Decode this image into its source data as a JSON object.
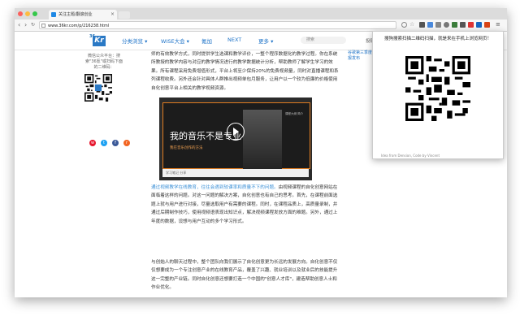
{
  "browser": {
    "tab_title": "关注主题/翻滚创业",
    "url": "www.36kr.com/p/216238.html",
    "colors": {
      "close": "#fc605c",
      "min": "#fdbc40",
      "max": "#34c84a"
    }
  },
  "site": {
    "logo_small": "36",
    "logo_big": "Kr",
    "nav": [
      "分类浏览 ▾",
      "WISE大会 ▾",
      "氪加",
      "NEXT",
      "更多 ▾"
    ],
    "search_placeholder": "搜索",
    "right_text": "投稿"
  },
  "left": {
    "text": "微信公众平台：搜索\"36氪\"或扫码下面的二维码："
  },
  "article": {
    "p1": "师的有效教学方式，同时提供学生选课和教学评价，一整个程序数据化的教学过程。你在系统所教授的教学内容与对应的教学情况进行的教学数据统计分析，帮助教师了解学生学习的效果。所有课程采用免费增值形式，平台上将至少保持20%的免费视频量，同时对直播课程和系列课程收费。另外还会针对具体人群推出视频单包月服务，让用户以一个较为低廉的价格使用自化创意平台上相关的教学视频资源。",
    "p2_link": "通过视频教学在线教育，往往会遇到较课率和质量不下的问题。",
    "p2": "由视频课程的自化创意网站在面临着这样的问题。对这一问题的解决方案，自化创意也有自己的思考。首先，在课程前面选题上就与用户进行对接，尽量选取用户有需要的课程。同时，在课程品质上，高质量录制，并通过后期制作技巧，使用视频语表现出知识点，解决视频课程发放方面的难题。另外，通过上年度的数据，设想与用户互动的多个学习形式。",
    "p3": "与创始人的聊天过程中，整个团队向我们展示了自化创意更为长远的发展方向。自化创意不仅仅想要成为一个专注创意产业的在线教育产品，覆盖了兴趣、就业培训以及就业后的技能提升这一完整的产业链。同时自化创意还想要打造一个中国的\"创意人才库\"，建造帮助创意人士和作业优化。"
  },
  "video": {
    "title": "我的音乐不是专业",
    "subtitle": "我在音乐创作的方法",
    "right_text": "课程大纲·简介",
    "bar": "学习笔记  分享"
  },
  "right_sidebar": {
    "text": "谷歌第三季度财报发布"
  },
  "popup": {
    "message": "搜狗搜索扫描二维码扫描，就是来在手机上浏览网页！",
    "credit": "Idea from Dension, Code by Vincent"
  }
}
